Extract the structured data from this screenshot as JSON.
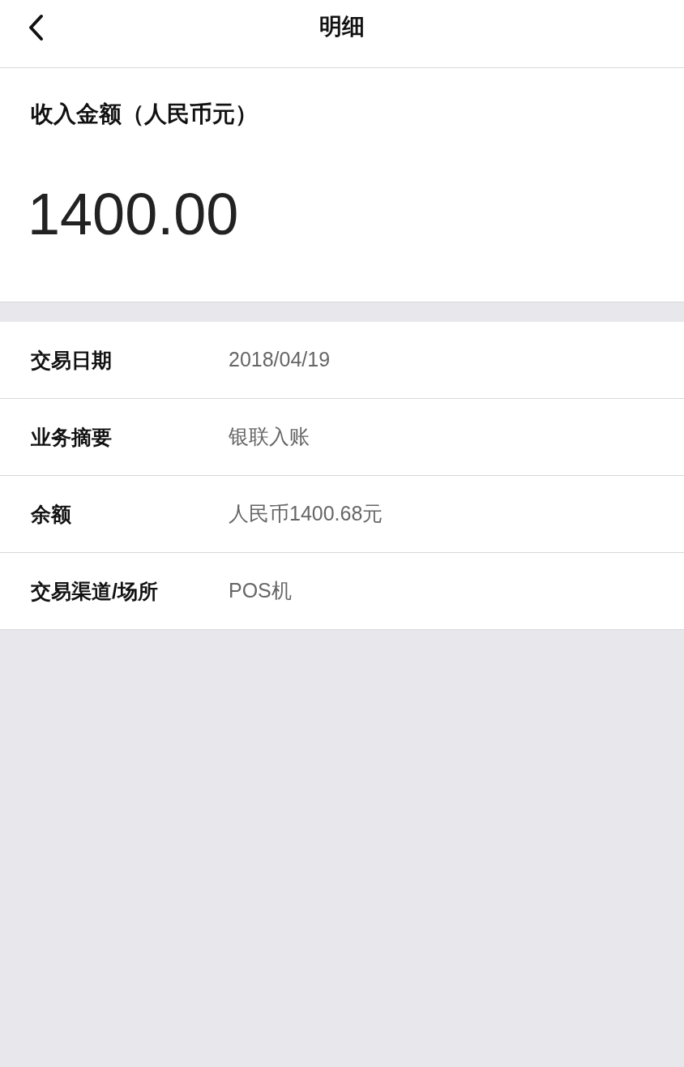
{
  "header": {
    "title": "明细"
  },
  "income": {
    "label": "收入金额（人民币元）",
    "amount": "1400.00"
  },
  "details": [
    {
      "label": "交易日期",
      "value": "2018/04/19"
    },
    {
      "label": "业务摘要",
      "value": "银联入账"
    },
    {
      "label": "余额",
      "value": "人民币1400.68元"
    },
    {
      "label": "交易渠道/场所",
      "value": "POS机"
    }
  ]
}
